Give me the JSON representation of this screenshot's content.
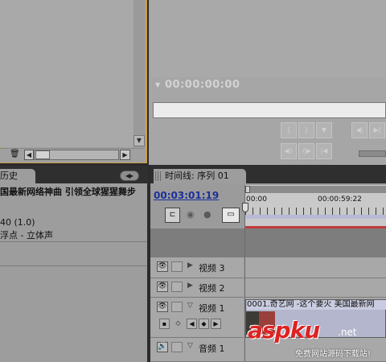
{
  "project_panel": {
    "trash_icon": "🗑",
    "scroll_left": "◀",
    "scroll_right": "▶",
    "scroll_down": "▼"
  },
  "monitor": {
    "marker_glyph": "▼",
    "timecode": "00:00:00:00",
    "transport": [
      "{",
      "}",
      "▼",
      "|◀",
      "◀}",
      "{▶",
      "◀|",
      "▶|"
    ]
  },
  "history": {
    "tab_label": "历史",
    "menu_glyph": "◀▸",
    "title": "国最新网络神曲 引领全球猩猩舞步",
    "line1": "40 (1.0)",
    "line2": "浮点 - 立体声"
  },
  "timeline": {
    "tab_label": "时间线: 序列 01",
    "close_glyph": "×",
    "current_time": "00:03:01:19",
    "ruler_labels": [
      "00:00",
      "00:00:59:22"
    ],
    "tools": {
      "snap": "⊏",
      "marker": "◉",
      "keyframe": "●",
      "sync": "▭"
    },
    "tracks": [
      {
        "name": "视频 3",
        "type": "video",
        "expanded": false
      },
      {
        "name": "视频 2",
        "type": "video",
        "expanded": false
      },
      {
        "name": "视频 1",
        "type": "video",
        "expanded": true
      },
      {
        "name": "音频 1",
        "type": "audio",
        "expanded": false
      }
    ],
    "clip_label": "0001.奇艺网 -这个要火 美国最新网",
    "eye_glyph": "👁",
    "speaker_glyph": "🔊"
  },
  "watermark": {
    "brand": "aspku",
    "suffix": ".net",
    "tagline": "免费网站源码下载站!"
  }
}
